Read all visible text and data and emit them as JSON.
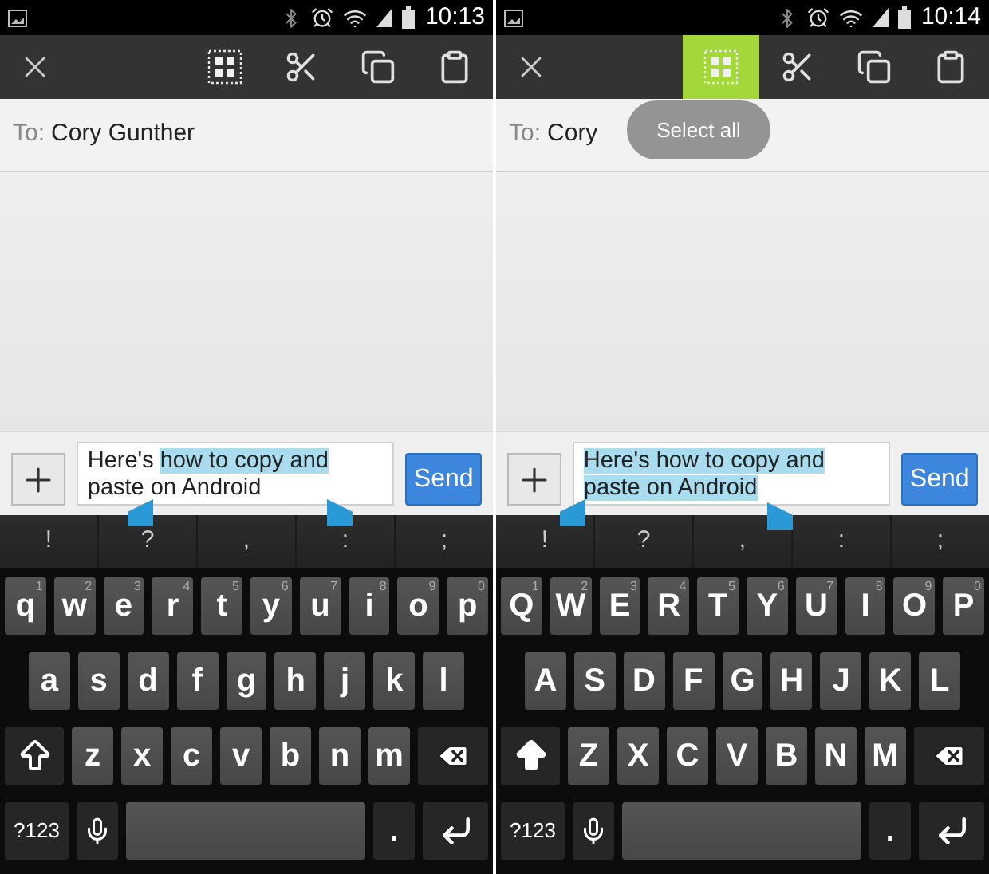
{
  "phones": [
    {
      "status_bar": {
        "time": "10:13"
      },
      "action_bar": {
        "buttons": [
          {
            "kind": "select_all",
            "selected": false
          },
          {
            "kind": "cut",
            "selected": false
          },
          {
            "kind": "copy",
            "selected": false
          },
          {
            "kind": "paste",
            "selected": false
          }
        ]
      },
      "to_field": {
        "label": "To:",
        "value": "Cory Gunther"
      },
      "compose": {
        "lines": [
          {
            "segments": [
              {
                "text": "Here's ",
                "selected": false
              },
              {
                "text": "how to copy and",
                "selected": true
              }
            ]
          },
          {
            "segments": [
              {
                "text": "paste on Android",
                "selected": false
              }
            ]
          }
        ],
        "send": "Send"
      },
      "suggestions": [
        "!",
        "?",
        ",",
        ":",
        ";"
      ],
      "keyboard": {
        "shift": false,
        "row_1": [
          {
            "label": "q",
            "hint": "1"
          },
          {
            "label": "w",
            "hint": "2"
          },
          {
            "label": "e",
            "hint": "3"
          },
          {
            "label": "r",
            "hint": "4"
          },
          {
            "label": "t",
            "hint": "5"
          },
          {
            "label": "y",
            "hint": "6"
          },
          {
            "label": "u",
            "hint": "7"
          },
          {
            "label": "i",
            "hint": "8"
          },
          {
            "label": "o",
            "hint": "9"
          },
          {
            "label": "p",
            "hint": "0"
          }
        ],
        "row_2": [
          "a",
          "s",
          "d",
          "f",
          "g",
          "h",
          "j",
          "k",
          "l"
        ],
        "row_3": [
          "z",
          "x",
          "c",
          "v",
          "b",
          "n",
          "m"
        ],
        "symbols": "?123",
        "period": "."
      }
    },
    {
      "status_bar": {
        "time": "10:14"
      },
      "action_bar": {
        "buttons": [
          {
            "kind": "select_all",
            "selected": true
          },
          {
            "kind": "cut",
            "selected": false
          },
          {
            "kind": "copy",
            "selected": false
          },
          {
            "kind": "paste",
            "selected": false
          }
        ]
      },
      "toast": "Select all",
      "to_field": {
        "label": "To:",
        "value": "Cory"
      },
      "compose": {
        "lines": [
          {
            "segments": [
              {
                "text": "Here's how to copy and",
                "selected": true
              }
            ]
          },
          {
            "segments": [
              {
                "text": "paste on Android",
                "selected": true
              }
            ]
          }
        ],
        "send": "Send"
      },
      "suggestions": [
        "!",
        "?",
        ",",
        ":",
        ";"
      ],
      "keyboard": {
        "shift": true,
        "row_1": [
          {
            "label": "Q",
            "hint": "1"
          },
          {
            "label": "W",
            "hint": "2"
          },
          {
            "label": "E",
            "hint": "3"
          },
          {
            "label": "R",
            "hint": "4"
          },
          {
            "label": "T",
            "hint": "5"
          },
          {
            "label": "Y",
            "hint": "6"
          },
          {
            "label": "U",
            "hint": "7"
          },
          {
            "label": "I",
            "hint": "8"
          },
          {
            "label": "O",
            "hint": "9"
          },
          {
            "label": "P",
            "hint": "0"
          }
        ],
        "row_2": [
          "A",
          "S",
          "D",
          "F",
          "G",
          "H",
          "J",
          "K",
          "L"
        ],
        "row_3": [
          "Z",
          "X",
          "C",
          "V",
          "B",
          "N",
          "M"
        ],
        "symbols": "?123",
        "period": "."
      }
    }
  ]
}
